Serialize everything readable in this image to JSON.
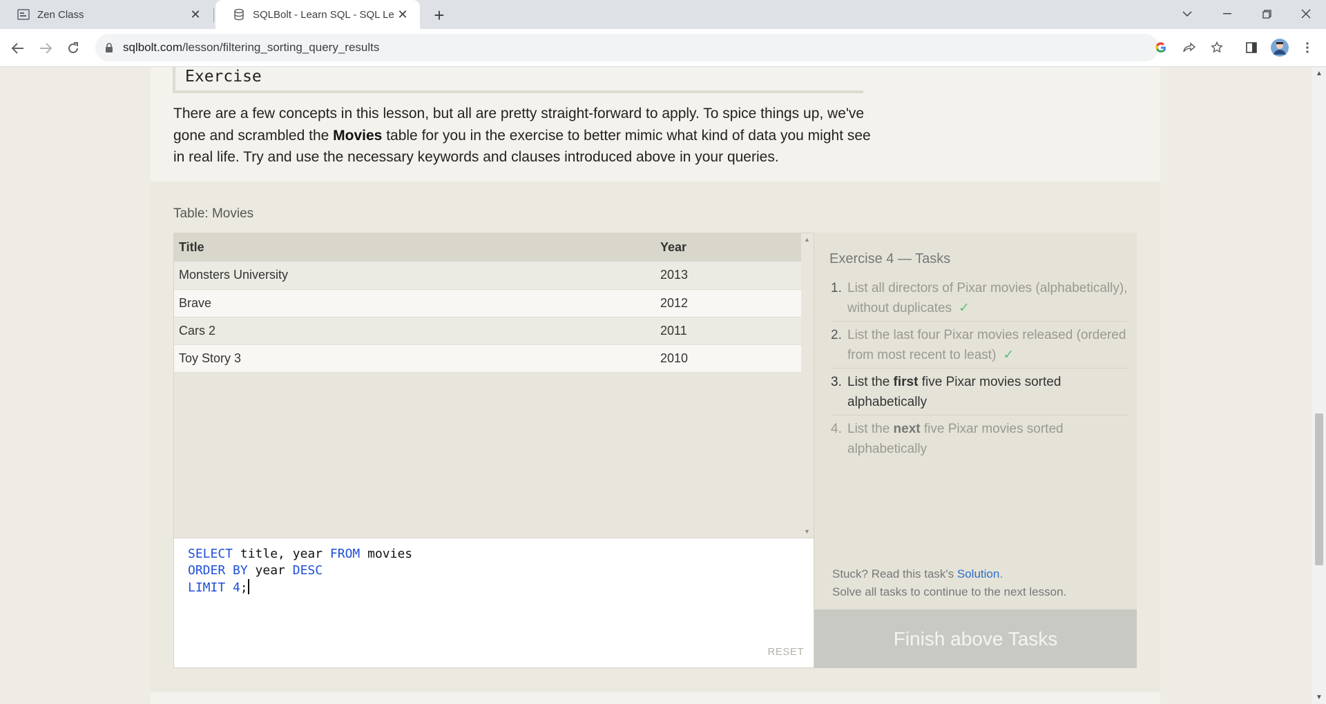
{
  "browser": {
    "tabs": [
      {
        "title": "Zen Class",
        "icon": "page-icon"
      },
      {
        "title": "SQLBolt - Learn SQL - SQL Lesso",
        "icon": "database-icon"
      }
    ],
    "url_host": "sqlbolt.com",
    "url_path": "/lesson/filtering_sorting_query_results"
  },
  "lesson": {
    "heading": "Exercise",
    "intro_part1": "There are a few concepts in this lesson, but all are pretty straight-forward to apply. To spice things up, we've gone and scrambled the ",
    "intro_bold": "Movies",
    "intro_part2": " table for you in the exercise to better mimic what kind of data you might see in real life. Try and use the necessary keywords and clauses introduced above in your queries."
  },
  "results": {
    "caption": "Table: Movies",
    "columns": [
      "Title",
      "Year"
    ],
    "rows": [
      [
        "Monsters University",
        "2013"
      ],
      [
        "Brave",
        "2012"
      ],
      [
        "Cars 2",
        "2011"
      ],
      [
        "Toy Story 3",
        "2010"
      ]
    ]
  },
  "editor": {
    "line1_kw1": "SELECT",
    "line1_mid": " title, year ",
    "line1_kw2": "FROM",
    "line1_end": " movies",
    "line2_kw1": "ORDER BY",
    "line2_mid": " year ",
    "line2_kw2": "DESC",
    "line3_kw1": "LIMIT",
    "line3_num": " 4",
    "line3_end": ";",
    "reset_label": "RESET"
  },
  "tasks": {
    "title": "Exercise 4 — Tasks",
    "items": [
      {
        "num": "1.",
        "text": "List all directors of Pixar movies (alphabetically), without duplicates",
        "status": "done"
      },
      {
        "num": "2.",
        "text": "List the last four Pixar movies released (ordered from most recent to least)",
        "status": "done"
      },
      {
        "num": "3.",
        "pre": "List the ",
        "bold": "first",
        "post": " five Pixar movies sorted alphabetically",
        "status": "current"
      },
      {
        "num": "4.",
        "pre": "List the ",
        "bold": "next",
        "post": " five Pixar movies sorted alphabetically",
        "status": "pending"
      }
    ],
    "check_mark": "✓",
    "stuck_text": "Stuck? Read this task's ",
    "solution_link": "Solution",
    "stuck_end": ".",
    "solve_all": "Solve all tasks to continue to the next lesson.",
    "finish_button": "Finish above Tasks"
  }
}
